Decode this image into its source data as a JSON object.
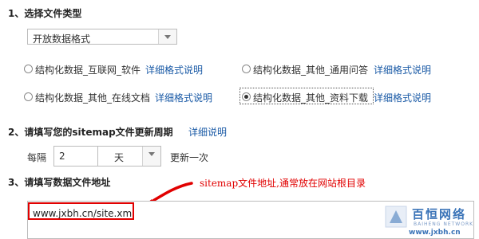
{
  "section1": {
    "title": "1、选择文件类型",
    "file_type_select": {
      "value": "开放数据格式"
    },
    "options": [
      {
        "label": "结构化数据_互联网_软件",
        "link": "详细格式说明",
        "checked": false
      },
      {
        "label": "结构化数据_其他_通用问答",
        "link": "详细格式说明",
        "checked": false
      },
      {
        "label": "结构化数据_其他_在线文档",
        "link": "详细格式说明",
        "checked": false
      },
      {
        "label": "结构化数据_其他_资料下载",
        "link": "详细格式说明",
        "checked": true
      }
    ]
  },
  "section2": {
    "title": "2、请填写您的sitemap文件更新周期",
    "help_link": "详细说明",
    "every_label": "每隔",
    "interval_value": "2",
    "unit_select": {
      "value": "天"
    },
    "suffix": "更新一次"
  },
  "section3": {
    "title": "3、请填写数据文件地址",
    "annotation": "sitemap文件地址,通常放在网站根目录",
    "url_value": "www.jxbh.cn/site.xml"
  },
  "watermark": {
    "brand_cn": "百恒网络",
    "brand_en": "BAIHENG NETWORK",
    "url": "www.jxbh.cn"
  },
  "colors": {
    "link": "#1a5aa6",
    "annotation": "#e10000",
    "watermark_blue": "#3b74b8"
  }
}
